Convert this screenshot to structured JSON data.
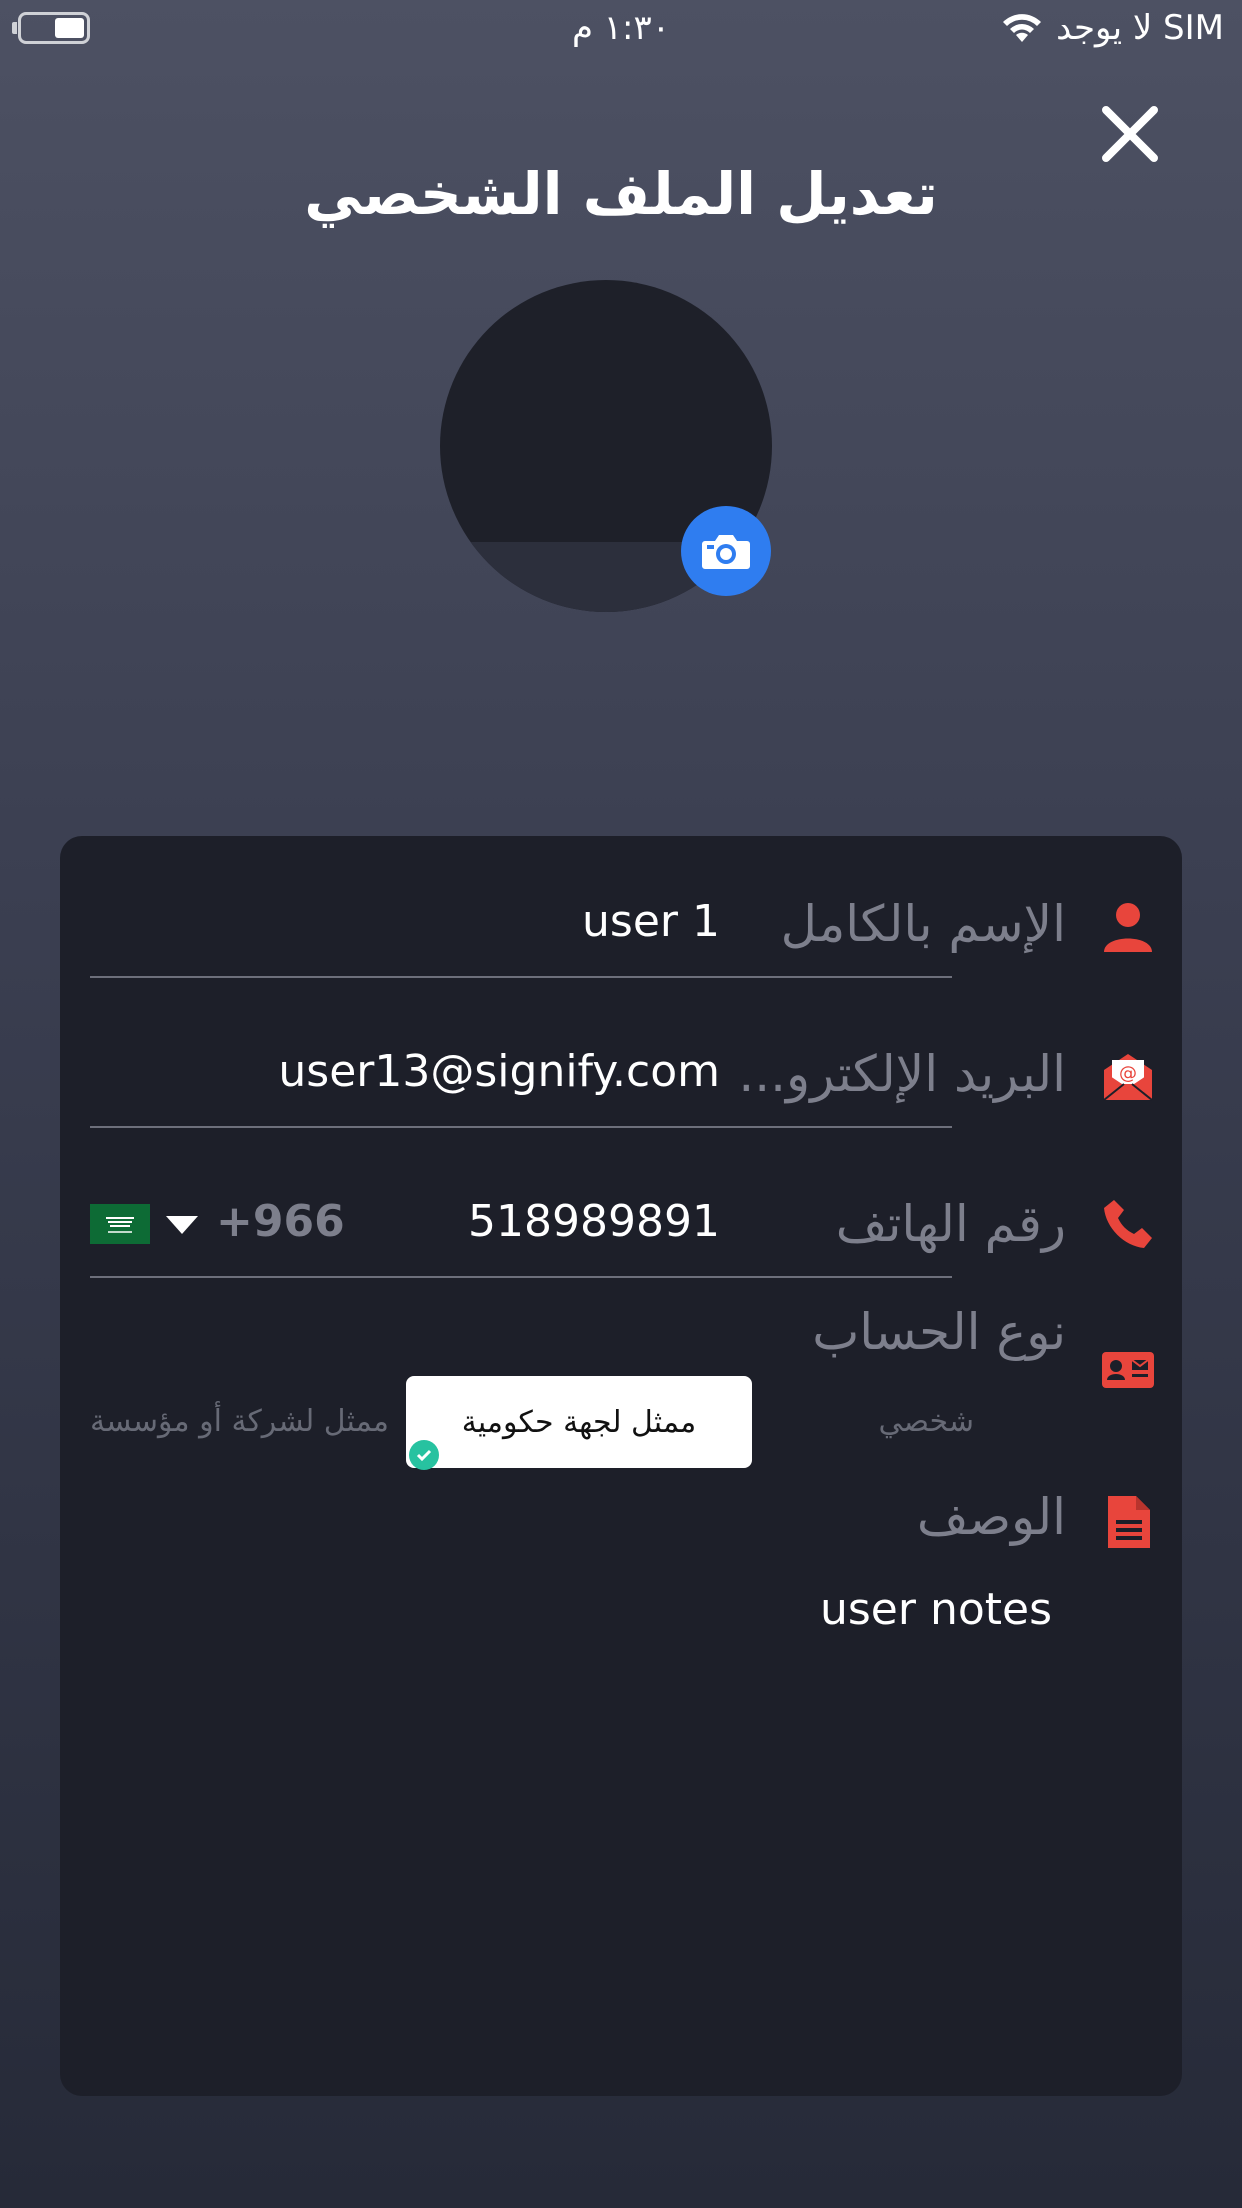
{
  "status_bar": {
    "carrier": "لا يوجد SIM",
    "time": "١:٣٠ م"
  },
  "header": {
    "title": "تعديل الملف الشخصي"
  },
  "colors": {
    "accent_red": "#e8453c",
    "camera_blue": "#2f7df0",
    "check_green": "#27c2a0",
    "card_bg": "#1d1f29"
  },
  "form": {
    "full_name": {
      "label": "الإسم بالكامل",
      "value": "user 1",
      "icon": "person-icon"
    },
    "email": {
      "label": "البريد الإلكترو...",
      "value": "user13@signify.com",
      "icon": "envelope-icon"
    },
    "phone": {
      "label": "رقم الهاتف",
      "value": "518989891",
      "country_code": "+966",
      "country_flag": "saudi-flag-icon",
      "icon": "phone-icon"
    },
    "account_type": {
      "label": "نوع الحساب",
      "icon": "id-card-icon",
      "options": [
        "شخصي",
        "ممثل لجهة حكومية",
        "ممثل لشركة أو مؤسسة"
      ],
      "selected": "ممثل لجهة حكومية"
    },
    "description": {
      "label": "الوصف",
      "value": "user notes",
      "icon": "document-icon"
    }
  }
}
